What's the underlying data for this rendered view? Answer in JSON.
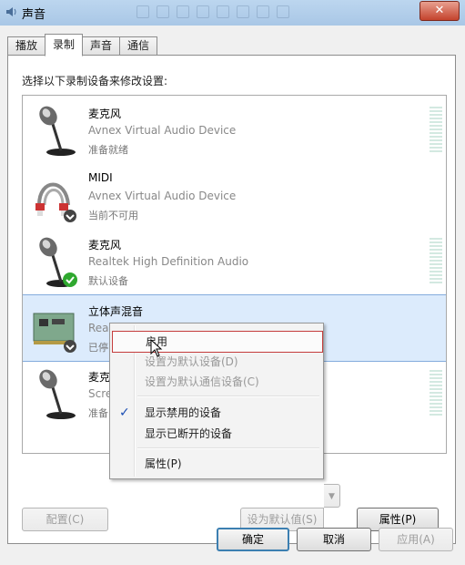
{
  "window": {
    "title": "声音",
    "close_label": "✕"
  },
  "tabs": [
    {
      "label": "播放"
    },
    {
      "label": "录制"
    },
    {
      "label": "声音"
    },
    {
      "label": "通信"
    }
  ],
  "instruction": "选择以下录制设备来修改设置:",
  "devices": [
    {
      "name": "麦克风",
      "driver": "Avnex Virtual Audio Device",
      "status": "准备就绪",
      "icon": "microphone-icon"
    },
    {
      "name": "MIDI",
      "driver": "Avnex Virtual Audio Device",
      "status": "当前不可用",
      "icon": "midi-cable-icon"
    },
    {
      "name": "麦克风",
      "driver": "Realtek High Definition Audio",
      "status": "默认设备",
      "icon": "microphone-icon"
    },
    {
      "name": "立体声混音",
      "driver": "Rea",
      "status": "已停",
      "icon": "sound-card-icon"
    },
    {
      "name": "麦克",
      "driver": "Scre",
      "status": "准备",
      "icon": "microphone-icon"
    }
  ],
  "context_menu": {
    "items": [
      {
        "label": "启用",
        "enabled": true,
        "hover": true
      },
      {
        "label": "设置为默认设备(D)",
        "enabled": false
      },
      {
        "label": "设置为默认通信设备(C)",
        "enabled": false
      },
      {
        "label": "显示禁用的设备",
        "enabled": true,
        "checked": true
      },
      {
        "label": "显示已断开的设备",
        "enabled": true
      },
      {
        "label": "属性(P)",
        "enabled": true
      }
    ],
    "check_glyph": "✓"
  },
  "panel_buttons": {
    "configure": "配置(C)",
    "set_default": "设为默认值(S)",
    "set_default_arrow": "▼",
    "properties": "属性(P)"
  },
  "dialog_buttons": {
    "ok": "确定",
    "cancel": "取消",
    "apply": "应用(A)"
  },
  "colors": {
    "selection": "#dcebfc",
    "menu_hover_border": "#c43c3c",
    "default_badge": "#2fa82f"
  }
}
